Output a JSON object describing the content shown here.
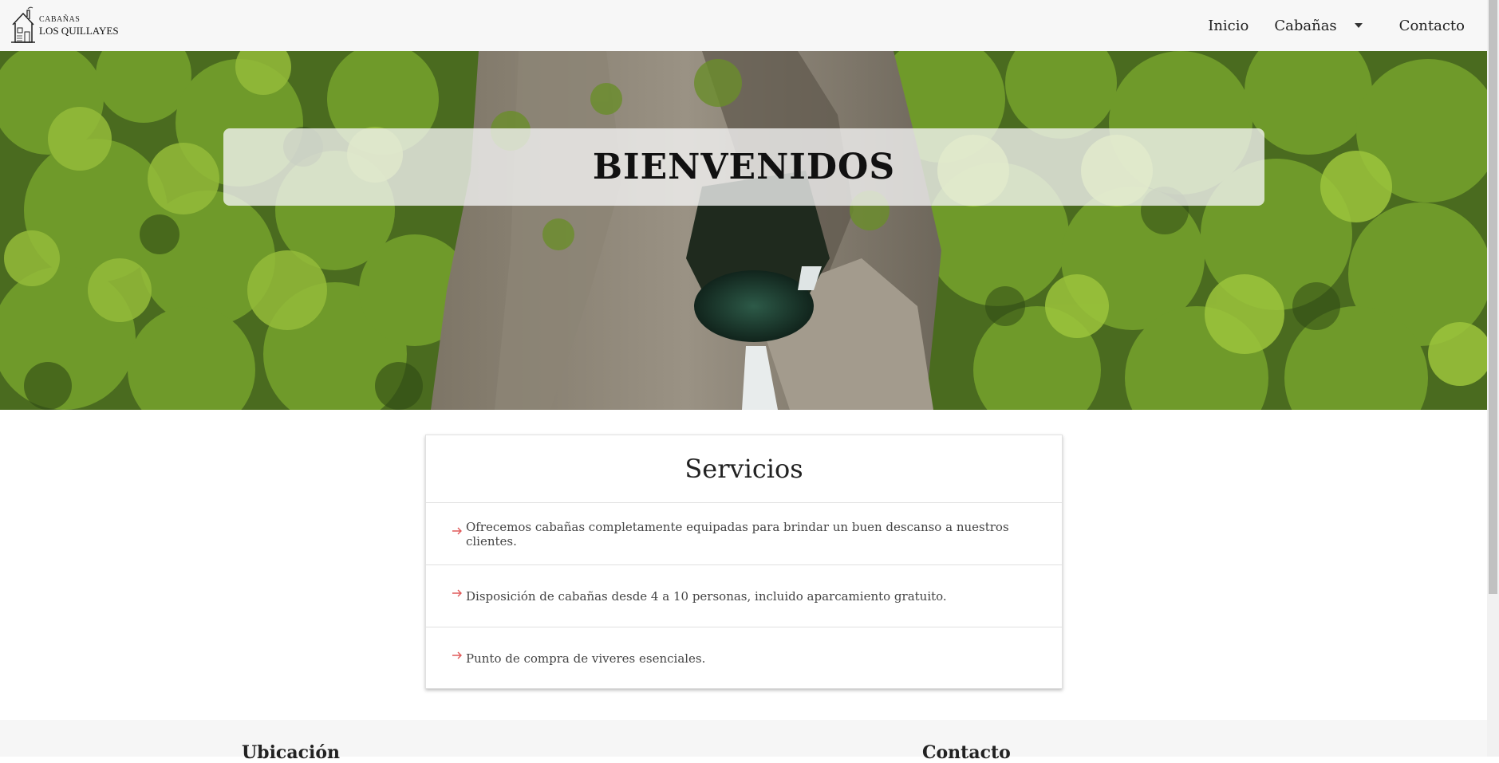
{
  "brand": {
    "line1": "CABAÑAS",
    "line2": "LOS QUILLAYES",
    "logo_icon": "house-cabin-icon"
  },
  "nav": {
    "items": [
      {
        "label": "Inicio"
      },
      {
        "label": "Cabañas",
        "has_dropdown": true
      },
      {
        "label": "Contacto"
      }
    ]
  },
  "hero": {
    "title": "BIENVENIDOS"
  },
  "services": {
    "title": "Servicios",
    "items": [
      {
        "text": "Ofrecemos cabañas completamente equipadas para brindar un buen descanso a nuestros clientes."
      },
      {
        "text": "Disposición de cabañas desde 4 a 10 personas, incluido aparcamiento gratuito."
      },
      {
        "text": "Punto de compra de viveres esenciales."
      }
    ],
    "icon": "arrow-right-icon",
    "icon_color": "#e05a5a"
  },
  "footer": {
    "col1_title": "Ubicación",
    "col2_title": "Contacto"
  }
}
